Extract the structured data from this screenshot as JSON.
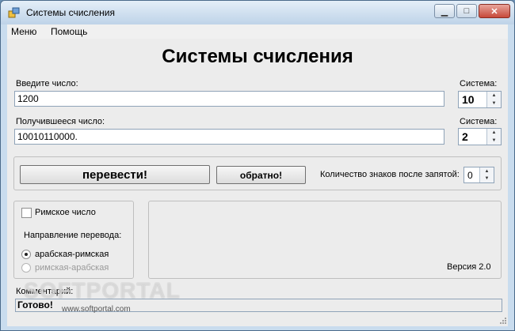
{
  "window": {
    "title": "Системы счисления",
    "icon": "app-window-icon",
    "controls": [
      "minimize-icon",
      "maximize-icon",
      "close-icon"
    ]
  },
  "menu": {
    "items": [
      "Меню",
      "Помощь"
    ]
  },
  "main": {
    "heading": "Системы счисления",
    "input_label": "Введите число:",
    "input_value": "1200",
    "input_system_label": "Система:",
    "input_system_value": "10",
    "output_label": "Получившееся число:",
    "output_value": "10010110000.",
    "output_system_label": "Система:",
    "output_system_value": "2"
  },
  "actions": {
    "convert_label": "перевести!",
    "reverse_label": "обратно!",
    "decimals_label": "Количество знаков после запятой:",
    "decimals_value": "0"
  },
  "roman": {
    "checkbox_label": "Римское число",
    "direction_label": "Направление перевода:",
    "options": [
      "арабская-римская",
      "римская-арабская"
    ],
    "selected_index": 0
  },
  "info": {
    "version": "Версия 2.0"
  },
  "comment": {
    "label": "Комментарий:",
    "status": "Готово!"
  },
  "watermark": {
    "logo_text": "SOFTPORTAL",
    "url": "www.softportal.com"
  }
}
